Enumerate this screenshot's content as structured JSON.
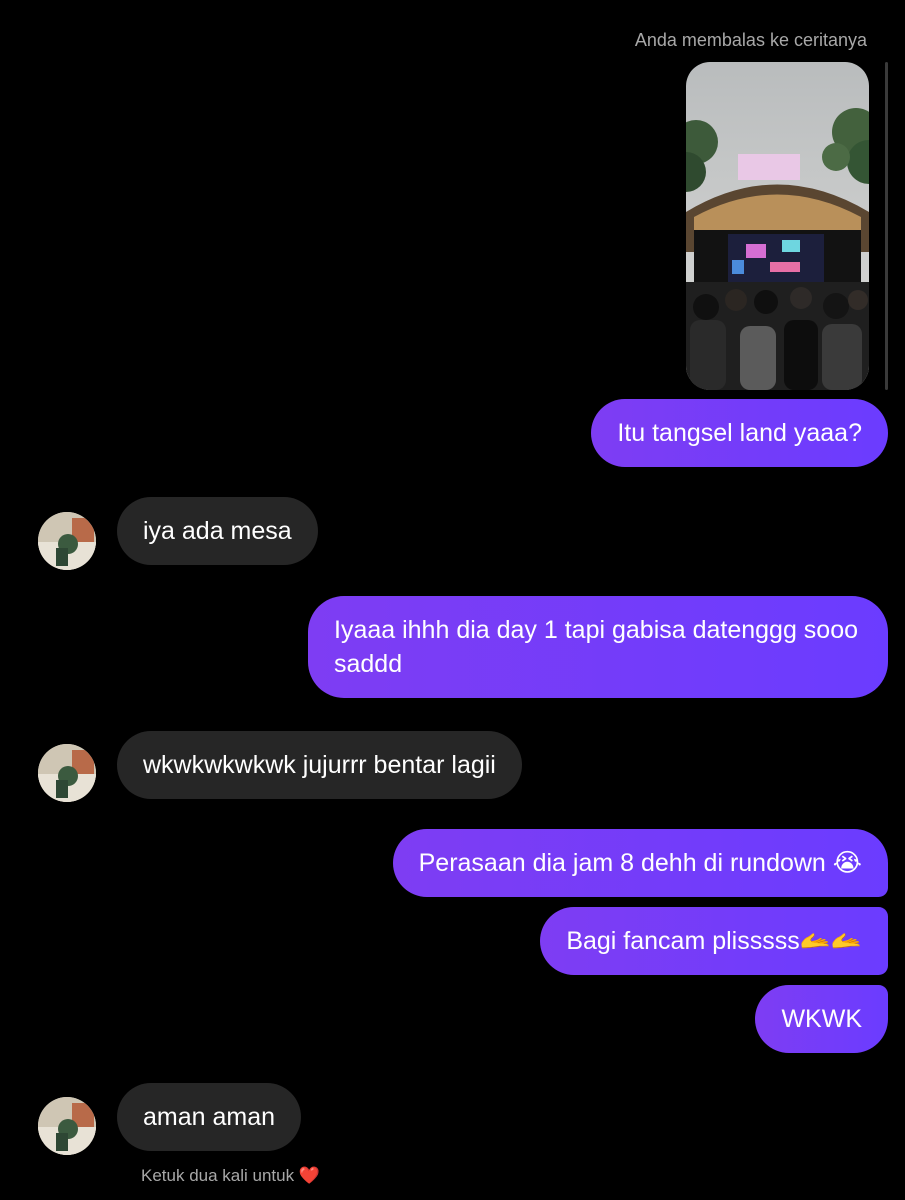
{
  "reply_note": "Anda membalas ke ceritanya",
  "messages": [
    {
      "dir": "out",
      "text": "Itu tangsel land yaaa?"
    },
    {
      "dir": "in",
      "text": "iya ada mesa"
    },
    {
      "dir": "out",
      "text": "Iyaaa ihhh dia day 1 tapi gabisa datenggg sooo saddd"
    },
    {
      "dir": "in",
      "text": "wkwkwkwkwk jujurrr bentar lagii"
    },
    {
      "dir": "out",
      "text": "Perasaan dia jam 8 dehh di rundown 😭"
    },
    {
      "dir": "out",
      "text": "Bagi fancam plisssss🫴🫴"
    },
    {
      "dir": "out",
      "text": "WKWK"
    },
    {
      "dir": "in",
      "text": "aman aman"
    }
  ],
  "footer_hint": "Ketuk dua kali untuk",
  "footer_heart": "❤️",
  "colors": {
    "outgoing": "#7b3cf6",
    "incoming": "#262626",
    "background": "#000000"
  }
}
